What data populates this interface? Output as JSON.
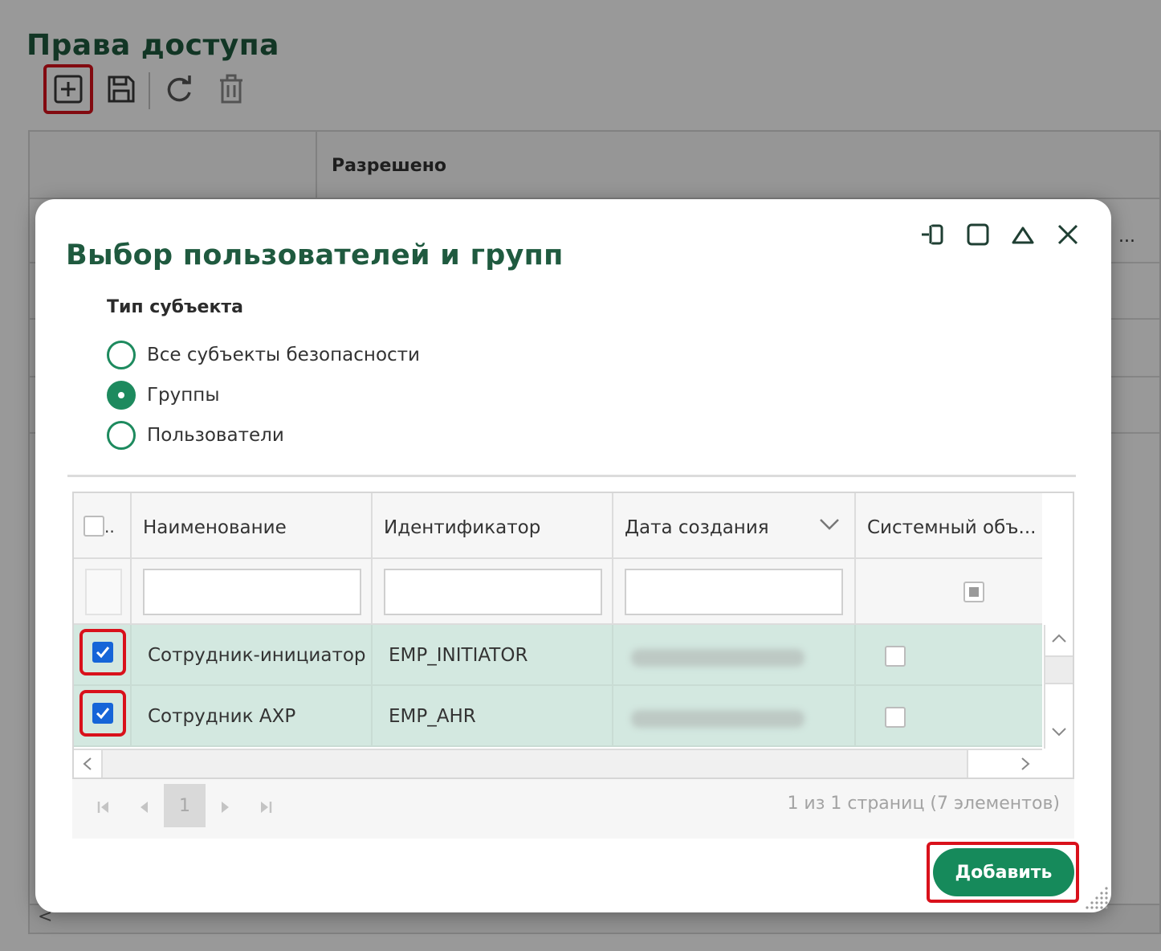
{
  "page": {
    "title": "Права доступа",
    "table_header": "Разрешено",
    "ellipsis": "...",
    "bottom_scroll_left": "<"
  },
  "toolbar": {
    "add_icon": "plus-square-icon",
    "save_icon": "floppy-disk-icon",
    "refresh_icon": "refresh-icon",
    "delete_icon": "trash-icon"
  },
  "dialog": {
    "title": "Выбор пользователей и групп",
    "window_controls": [
      "pin-icon",
      "maximize-icon",
      "collapse-icon",
      "close-icon"
    ],
    "subject_type": {
      "label": "Тип субъекта",
      "options": [
        {
          "label": "Все субъекты безопасности",
          "checked": false
        },
        {
          "label": "Группы",
          "checked": true
        },
        {
          "label": "Пользователи",
          "checked": false
        }
      ]
    },
    "grid": {
      "select_all": "..",
      "columns": [
        "Наименование",
        "Идентификатор",
        "Дата создания",
        "Системный объ..."
      ],
      "rows": [
        {
          "name": "Сотрудник-инициатор",
          "id": "EMP_INITIATOR",
          "selected": true,
          "system": false
        },
        {
          "name": "Сотрудник АХР",
          "id": "EMP_AHR",
          "selected": true,
          "system": false
        }
      ]
    },
    "pager": {
      "current_page": "1",
      "info": "1 из 1 страниц (7 элементов)"
    },
    "add_button": "Добавить"
  },
  "colors": {
    "accent": "#168a5b",
    "title": "#1f5a3f",
    "highlight": "#d9111b",
    "selected_row": "#d3e8e0",
    "checkbox": "#1565d8"
  }
}
